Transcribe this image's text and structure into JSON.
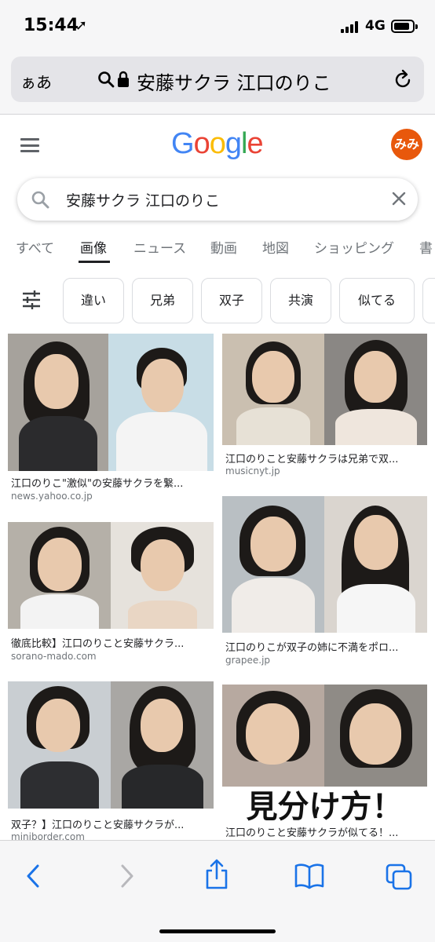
{
  "status": {
    "time": "15:44",
    "location_glyph": "➚",
    "network": "4G",
    "battery_level": 0.85
  },
  "browser": {
    "aa_label": "ぁあ",
    "url": "安藤サクラ 江口のりこ",
    "icons": [
      "search-icon",
      "lock-icon",
      "reload-icon"
    ]
  },
  "google": {
    "logo": [
      "G",
      "o",
      "o",
      "g",
      "l",
      "e"
    ],
    "logo_colors": [
      "#4285F4",
      "#EA4335",
      "#FBBC05",
      "#4285F4",
      "#34A853",
      "#EA4335"
    ],
    "avatar": "みみ",
    "avatar_color": "#e8580c"
  },
  "search": {
    "query": "安藤サクラ 江口のりこ"
  },
  "tabs": [
    "すべて",
    "画像",
    "ニュース",
    "動画",
    "地図",
    "ショッピング",
    "書"
  ],
  "active_tab": "画像",
  "chips": [
    "違い",
    "兄弟",
    "双子",
    "共演",
    "似てる"
  ],
  "results": [
    {
      "caption": "江口のりこ\"激似\"の安藤サクラを繋...",
      "source": "news.yahoo.co.jp"
    },
    {
      "caption": "江口のりこと安藤サクラは兄弟で双...",
      "source": "musicnyt.jp"
    },
    {
      "caption": "徹底比較】江口のりこと安藤サクラ...",
      "source": "sorano-mado.com"
    },
    {
      "caption": "江口のりこが双子の姉に不満をポロ...",
      "source": "grapee.jp"
    },
    {
      "caption": "双子？】江口のりこと安藤サクラが...",
      "source": "miniborder.com"
    },
    {
      "caption": "江口のりこと安藤サクラが似てる！...",
      "source": "",
      "overlay": "見分け方！"
    }
  ],
  "toolbar": [
    "back-icon",
    "forward-icon",
    "share-icon",
    "bookmarks-icon",
    "tabs-icon"
  ],
  "accent": "#1a73e8"
}
